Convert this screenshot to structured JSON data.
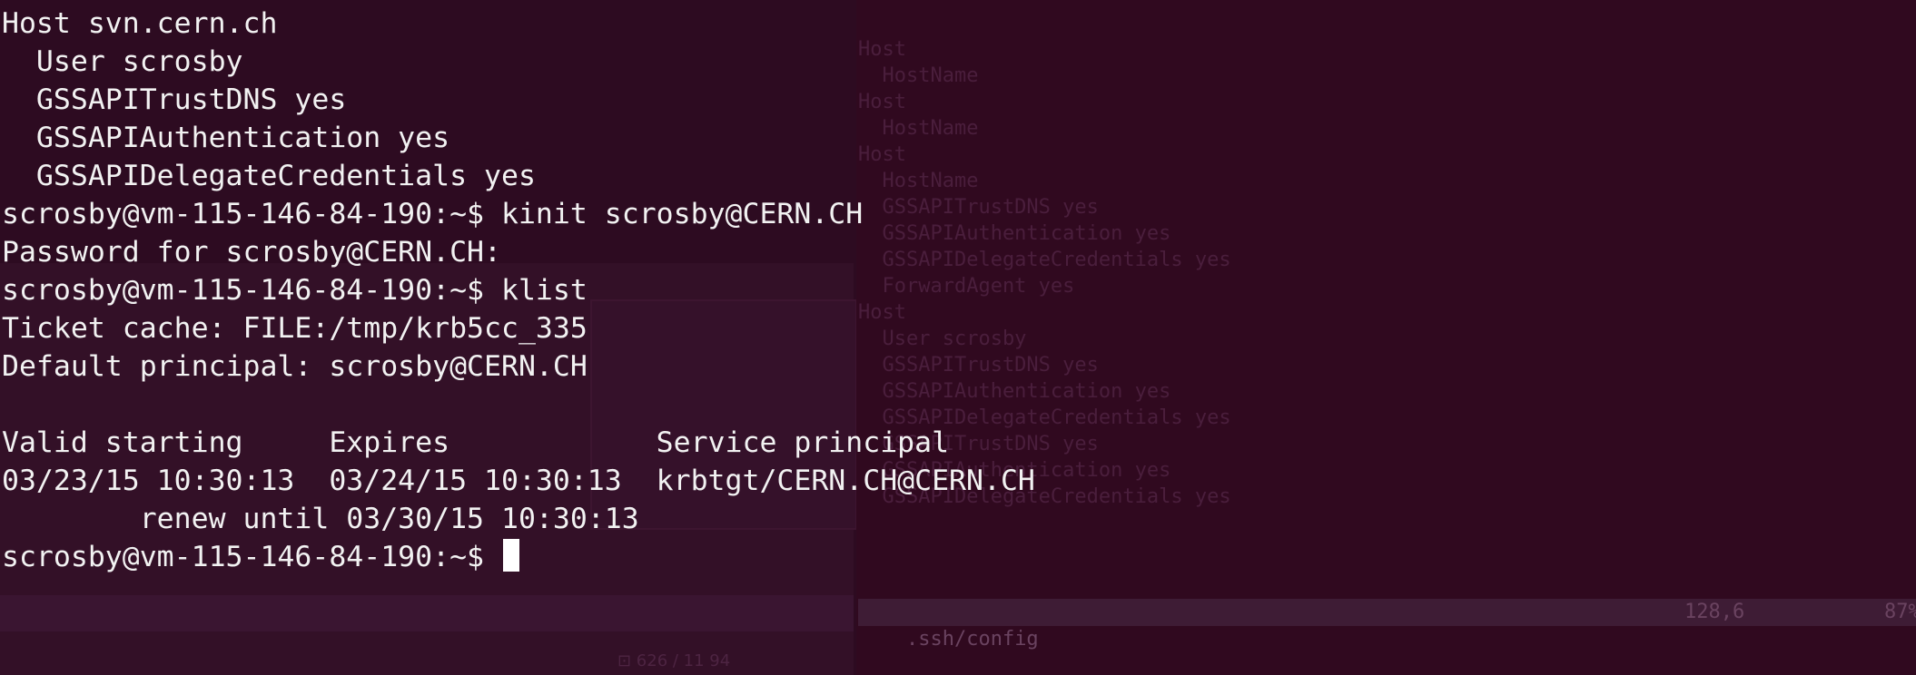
{
  "background": {
    "vim_lines": [
      "Host",
      "  HostName",
      "Host",
      "  HostName",
      "Host",
      "  HostName",
      "  GSSAPITrustDNS yes",
      "  GSSAPIAuthentication yes",
      "  GSSAPIDelegateCredentials yes",
      "  ForwardAgent yes",
      "Host",
      "  User scrosby",
      "  GSSAPITrustDNS yes",
      "  GSSAPIAuthentication yes",
      "  GSSAPIDelegateCredentials yes",
      "",
      "",
      "  GSSAPITrustDNS yes",
      "  GSSAPIAuthentication yes",
      "  GSSAPIDelegateCredentials yes"
    ],
    "status_file": ".ssh/config",
    "status_pos": "128,6",
    "status_pct": "87%",
    "footer_text": "⊡ 626 / 11 94"
  },
  "terminal": {
    "lines": [
      "Host svn.cern.ch",
      "  User scrosby",
      "  GSSAPITrustDNS yes",
      "  GSSAPIAuthentication yes",
      "  GSSAPIDelegateCredentials yes",
      "scrosby@vm-115-146-84-190:~$ kinit scrosby@CERN.CH",
      "Password for scrosby@CERN.CH:",
      "scrosby@vm-115-146-84-190:~$ klist",
      "Ticket cache: FILE:/tmp/krb5cc_335",
      "Default principal: scrosby@CERN.CH",
      "",
      "Valid starting     Expires            Service principal",
      "03/23/15 10:30:13  03/24/15 10:30:13  krbtgt/CERN.CH@CERN.CH",
      "        renew until 03/30/15 10:30:13"
    ],
    "prompt": "scrosby@vm-115-146-84-190:~$ "
  }
}
